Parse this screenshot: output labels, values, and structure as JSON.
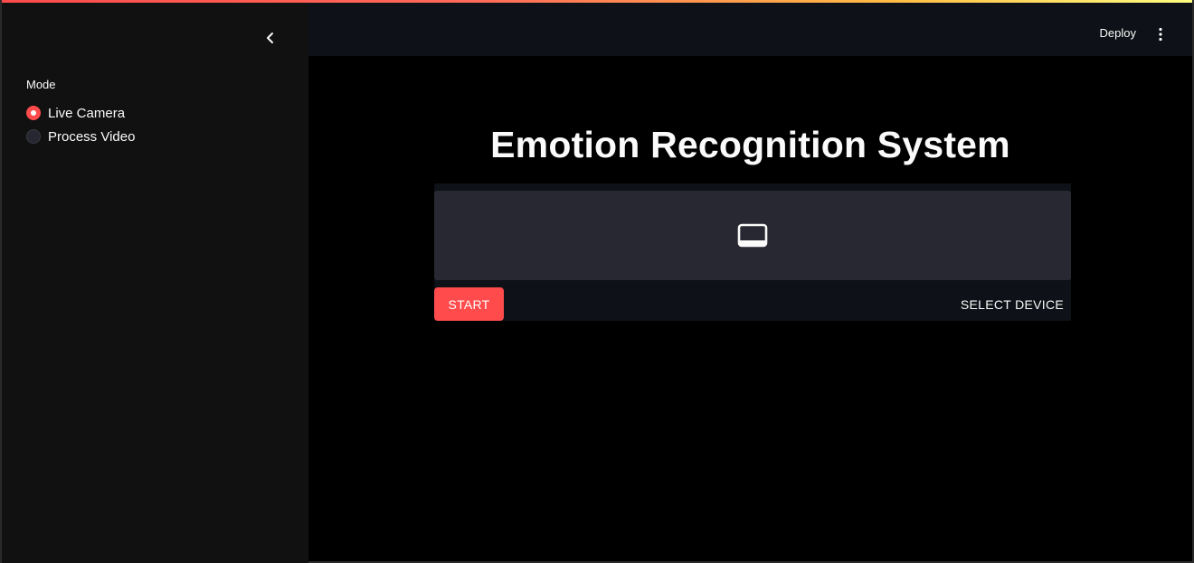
{
  "header": {
    "deploy_label": "Deploy",
    "menu_icon": "more-vertical-icon"
  },
  "sidebar": {
    "collapse_icon": "chevron-left-icon",
    "mode": {
      "label": "Mode",
      "options": [
        {
          "label": "Live Camera",
          "selected": true
        },
        {
          "label": "Process Video",
          "selected": false
        }
      ]
    }
  },
  "main": {
    "title": "Emotion Recognition System",
    "webrtc": {
      "placeholder_icon": "video-screen-icon",
      "start_label": "START",
      "select_device_label": "SELECT DEVICE"
    }
  },
  "colors": {
    "accent": "#ff4b4b",
    "sidebar_bg": "#111111",
    "header_bg": "#0e1117",
    "main_bg": "#000000",
    "video_bg": "#282833"
  }
}
